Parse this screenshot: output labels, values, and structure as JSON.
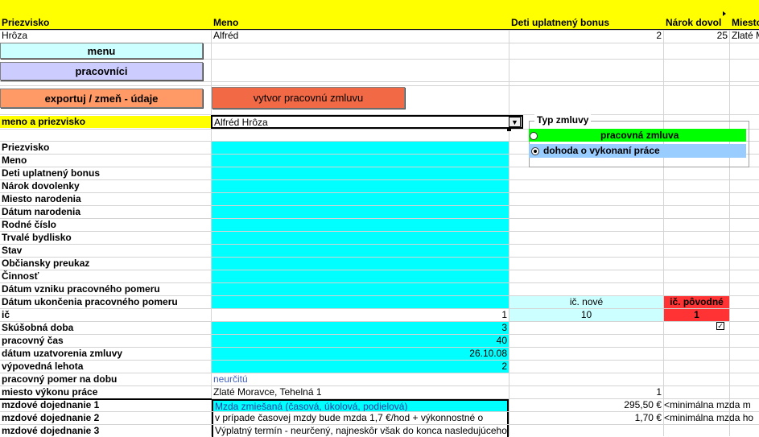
{
  "header": {
    "col_a": "Priezvisko",
    "col_b": "Meno",
    "col_c": "Deti uplatnený bonus",
    "col_d": "Nárok dovol",
    "col_e": "Miesto"
  },
  "record": {
    "priezvisko": "Hrôza",
    "meno": "Alfréd",
    "deti": "2",
    "narok": "25",
    "miesto": "Zlaté M"
  },
  "buttons": {
    "menu": "menu",
    "pracovnici": "pracovníci",
    "export": "exportuj / zmeň - údaje",
    "vytvor": "vytvor pracovnú zmluvu"
  },
  "selector": {
    "label": "meno a priezvisko",
    "value": "Alfréd Hrôza",
    "arrow": "dropdown-arrow"
  },
  "contract_type": {
    "title": "Typ zmluvy",
    "options": [
      "pracovná zmluva",
      "dohoda o vykonaní práce"
    ],
    "selected": "dohoda o vykonaní práce"
  },
  "fields": [
    {
      "label": "Priezvisko",
      "value": ""
    },
    {
      "label": "Meno",
      "value": ""
    },
    {
      "label": "Deti uplatnený bonus",
      "value": ""
    },
    {
      "label": "Nárok dovolenky",
      "value": ""
    },
    {
      "label": "Miesto narodenia",
      "value": ""
    },
    {
      "label": "Dátum narodenia",
      "value": ""
    },
    {
      "label": "Rodné číslo",
      "value": ""
    },
    {
      "label": "Trvalé bydlisko",
      "value": ""
    },
    {
      "label": "Stav",
      "value": ""
    },
    {
      "label": "Občiansky preukaz",
      "value": ""
    },
    {
      "label": "Činnosť",
      "value": ""
    },
    {
      "label": "Dátum vzniku pracovného pomeru",
      "value": ""
    },
    {
      "label": "Dátum ukončenia pracovného pomeru",
      "value": ""
    },
    {
      "label": "ič",
      "value": "1"
    },
    {
      "label": "Skúšobná doba",
      "value": "3"
    },
    {
      "label": "pracovný čas",
      "value": "40"
    },
    {
      "label": "dátum uzatvorenia zmluvy",
      "value": "26.10.08"
    },
    {
      "label": "výpovedná lehota",
      "value": "2"
    },
    {
      "label": "pracovný pomer na dobu",
      "value": "neurčitú"
    },
    {
      "label": "miesto výkonu práce",
      "value": "Zlaté Moravce, Tehelná 1"
    },
    {
      "label": "mzdové dojednanie 1",
      "value": "Mzda zmiešaná (časová, úkolová, podielová)"
    },
    {
      "label": "mzdové dojednanie 2",
      "value": "v prípade časovej mzdy bude mzda 1,7 €/hod + výkonnostné o"
    },
    {
      "label": "mzdové dojednanie 3",
      "value": "Výplatný termín - neurčený, najneskôr však do konca nasledujúceho kalendárneho mesiaca."
    }
  ],
  "ic_table": {
    "nove_label": "ič. nové",
    "povodne_label": "ič. pôvodné",
    "nove_value": "10",
    "povodne_value": "1"
  },
  "extra": {
    "miesto_num": "1",
    "mzda1_amount": "295,50 €",
    "mzda1_note": "<minimálna mzda m",
    "mzda2_amount": "1,70 €",
    "mzda2_note": "<minimálna mzda ho"
  },
  "colors": {
    "yellow": "#ffff00",
    "cyan": "#00ffff",
    "light_cyan": "#ccffff",
    "lavender": "#ccccff",
    "orange": "#ff9966",
    "red_orange": "#f26945",
    "red": "#ff3333",
    "green": "#00ff00",
    "light_blue": "#99ccff"
  }
}
